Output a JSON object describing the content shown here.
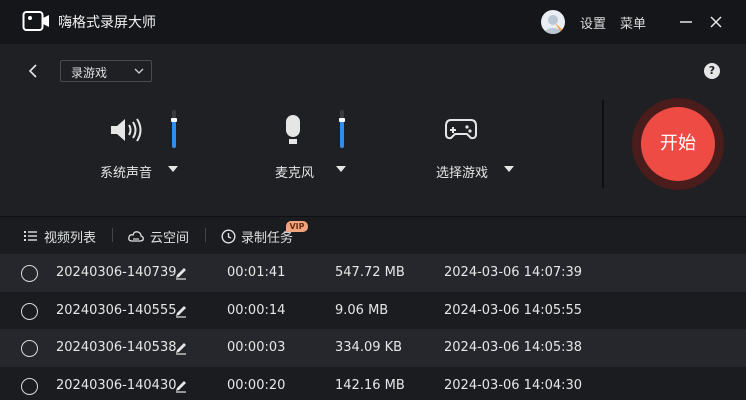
{
  "window": {
    "title": "嗨格式录屏大师",
    "settings_label": "设置",
    "menu_label": "菜单"
  },
  "toolbar": {
    "mode_value": "录游戏",
    "help_label": "?"
  },
  "controls": {
    "system_audio": {
      "label": "系统声音",
      "level": 0.75
    },
    "microphone": {
      "label": "麦克风",
      "level": 0.75
    },
    "game": {
      "label": "选择游戏"
    }
  },
  "start_button": {
    "label": "开始"
  },
  "tabs": [
    {
      "label": "视频列表"
    },
    {
      "label": "云空间"
    },
    {
      "label": "录制任务",
      "badge": "VIP"
    }
  ],
  "recordings": [
    {
      "name": "20240306-140739",
      "duration": "00:01:41",
      "size": "547.72 MB",
      "created": "2024-03-06 14:07:39"
    },
    {
      "name": "20240306-140555",
      "duration": "00:00:14",
      "size": "9.06 MB",
      "created": "2024-03-06 14:05:55"
    },
    {
      "name": "20240306-140538",
      "duration": "00:00:03",
      "size": "334.09 KB",
      "created": "2024-03-06 14:05:38"
    },
    {
      "name": "20240306-140430",
      "duration": "00:00:20",
      "size": "142.16 MB",
      "created": "2024-03-06 14:04:30"
    }
  ],
  "colors": {
    "accent": "#2f8ff0",
    "start": "#ef4b45",
    "vip": "#f0a57e"
  }
}
